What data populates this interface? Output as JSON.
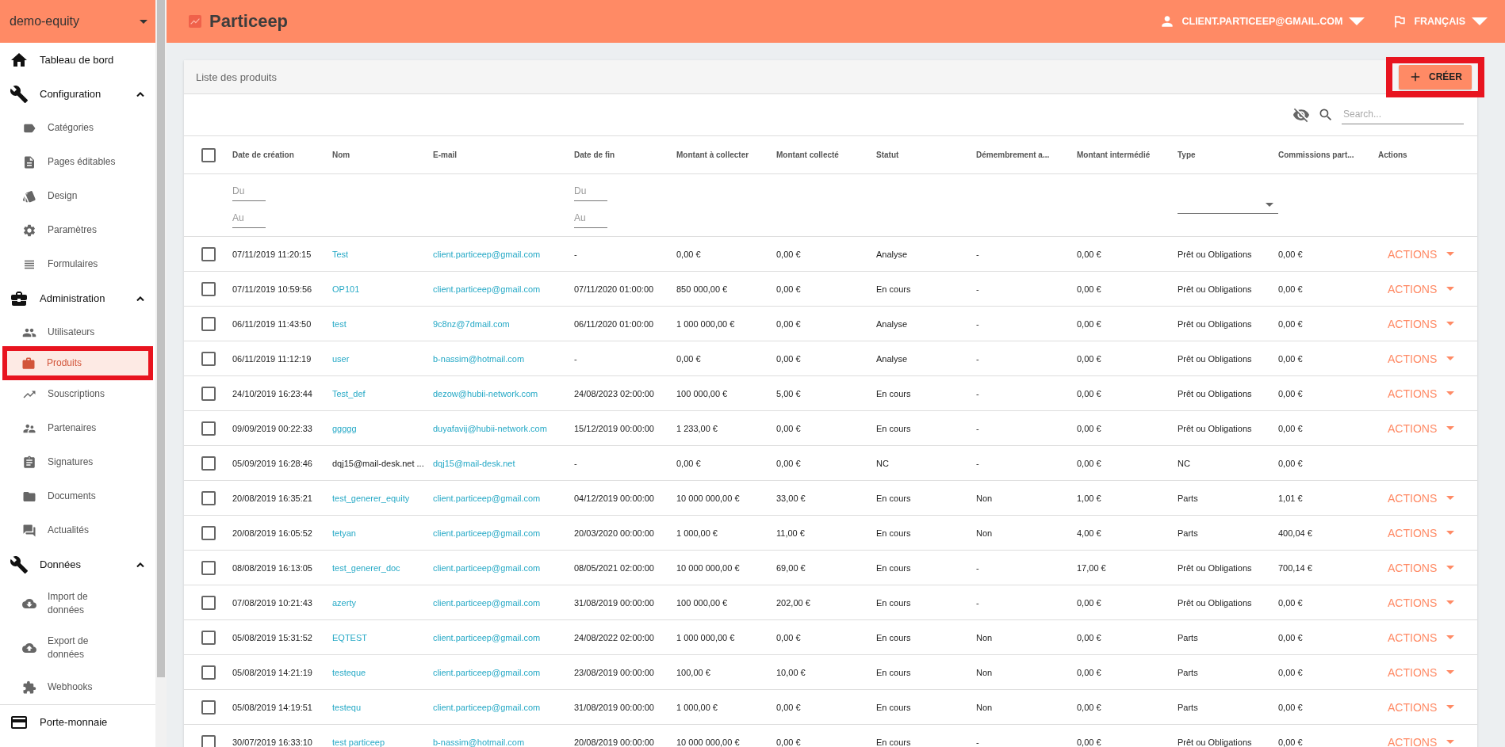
{
  "sidebar": {
    "account": "demo-equity",
    "sections": [
      {
        "label": "Tableau de bord",
        "kind": "link"
      },
      {
        "label": "Configuration",
        "kind": "group",
        "expanded": true,
        "children": [
          {
            "label": "Catégories",
            "selected": false,
            "highlighted": false
          },
          {
            "label": "Pages éditables",
            "selected": false,
            "highlighted": false
          },
          {
            "label": "Design",
            "selected": false,
            "highlighted": false
          },
          {
            "label": "Paramètres",
            "selected": false,
            "highlighted": false
          },
          {
            "label": "Formulaires",
            "selected": false,
            "highlighted": false
          }
        ]
      },
      {
        "label": "Administration",
        "kind": "group",
        "expanded": true,
        "children": [
          {
            "label": "Utilisateurs",
            "selected": false,
            "highlighted": false
          },
          {
            "label": "Produits",
            "selected": true,
            "highlighted": true
          },
          {
            "label": "Souscriptions",
            "selected": false,
            "highlighted": false
          },
          {
            "label": "Partenaires",
            "selected": false,
            "highlighted": false
          },
          {
            "label": "Signatures",
            "selected": false,
            "highlighted": false
          },
          {
            "label": "Documents",
            "selected": false,
            "highlighted": false
          },
          {
            "label": "Actualités",
            "selected": false,
            "highlighted": false
          }
        ]
      },
      {
        "label": "Données",
        "kind": "group",
        "expanded": true,
        "children": [
          {
            "label": "Import de données",
            "selected": false,
            "highlighted": false
          },
          {
            "label": "Export de données",
            "selected": false,
            "highlighted": false
          },
          {
            "label": "Webhooks",
            "selected": false,
            "highlighted": false
          }
        ]
      },
      {
        "label": "Porte-monnaie",
        "kind": "link"
      }
    ]
  },
  "header": {
    "brand": "Particeep",
    "user": "CLIENT.PARTICEEP@GMAIL.COM",
    "language": "FRANÇAIS"
  },
  "card": {
    "title": "Liste des produits",
    "create_button": {
      "label": "CRÉER",
      "highlighted": true
    },
    "search": {
      "placeholder": "Search..."
    },
    "table": {
      "columns": [
        "Date de création",
        "Nom",
        "E-mail",
        "Date de fin",
        "Montant à collecter",
        "Montant collecté",
        "Statut",
        "Démembrement a...",
        "Montant intermédié",
        "Type",
        "Commissions part...",
        "Actions"
      ],
      "all_checked": false,
      "filters": {
        "created_from": {
          "placeholder": "Du"
        },
        "created_to": {
          "placeholder": "Au"
        },
        "end_from": {
          "placeholder": "Du"
        },
        "end_to": {
          "placeholder": "Au"
        }
      },
      "rows": [
        {
          "checked": false,
          "created": "07/11/2019 11:20:15",
          "name": "Test",
          "name_link": true,
          "email": "client.particeep@gmail.com",
          "end": "-",
          "target": "0,00 €",
          "collected": "0,00 €",
          "status": "Analyse",
          "split": "-",
          "intermediated": "0,00 €",
          "type": "Prêt ou Obligations",
          "commission": "0,00 €",
          "actions": "ACTIONS"
        },
        {
          "checked": false,
          "created": "07/11/2019 10:59:56",
          "name": "OP101",
          "name_link": true,
          "email": "client.particeep@gmail.com",
          "end": "07/11/2020 01:00:00",
          "target": "850 000,00 €",
          "collected": "0,00 €",
          "status": "En cours",
          "split": "-",
          "intermediated": "0,00 €",
          "type": "Prêt ou Obligations",
          "commission": "0,00 €",
          "actions": "ACTIONS"
        },
        {
          "checked": false,
          "created": "06/11/2019 11:43:50",
          "name": "test",
          "name_link": true,
          "email": "9c8nz@7dmail.com",
          "end": "06/11/2020 01:00:00",
          "target": "1 000 000,00 €",
          "collected": "0,00 €",
          "status": "Analyse",
          "split": "-",
          "intermediated": "0,00 €",
          "type": "Prêt ou Obligations",
          "commission": "0,00 €",
          "actions": "ACTIONS"
        },
        {
          "checked": false,
          "created": "06/11/2019 11:12:19",
          "name": "user",
          "name_link": true,
          "email": "b-nassim@hotmail.com",
          "end": "-",
          "target": "0,00 €",
          "collected": "0,00 €",
          "status": "Analyse",
          "split": "-",
          "intermediated": "0,00 €",
          "type": "Prêt ou Obligations",
          "commission": "0,00 €",
          "actions": "ACTIONS"
        },
        {
          "checked": false,
          "created": "24/10/2019 16:23:44",
          "name": "Test_def",
          "name_link": true,
          "email": "dezow@hubii-network.com",
          "end": "24/08/2023 02:00:00",
          "target": "100 000,00 €",
          "collected": "5,00 €",
          "status": "En cours",
          "split": "-",
          "intermediated": "0,00 €",
          "type": "Prêt ou Obligations",
          "commission": "0,00 €",
          "actions": "ACTIONS"
        },
        {
          "checked": false,
          "created": "09/09/2019 00:22:33",
          "name": "ggggg",
          "name_link": true,
          "email": "duyafavij@hubii-network.com",
          "end": "15/12/2019 00:00:00",
          "target": "1 233,00 €",
          "collected": "0,00 €",
          "status": "En cours",
          "split": "-",
          "intermediated": "0,00 €",
          "type": "Prêt ou Obligations",
          "commission": "0,00 €",
          "actions": "ACTIONS"
        },
        {
          "checked": false,
          "created": "05/09/2019 16:28:46",
          "name": "dqj15@mail-desk.net ...",
          "name_link": false,
          "email": "dqj15@mail-desk.net",
          "end": "-",
          "target": "0,00 €",
          "collected": "0,00 €",
          "status": "NC",
          "split": "-",
          "intermediated": "0,00 €",
          "type": "NC",
          "commission": "0,00 €"
        },
        {
          "checked": false,
          "created": "20/08/2019 16:35:21",
          "name": "test_generer_equity",
          "name_link": true,
          "email": "client.particeep@gmail.com",
          "end": "04/12/2019 00:00:00",
          "target": "10 000 000,00 €",
          "collected": "33,00 €",
          "status": "En cours",
          "split": "Non",
          "intermediated": "1,00 €",
          "type": "Parts",
          "commission": "1,01 €",
          "actions": "ACTIONS"
        },
        {
          "checked": false,
          "created": "20/08/2019 16:05:52",
          "name": "tetyan",
          "name_link": true,
          "email": "client.particeep@gmail.com",
          "end": "20/03/2020 00:00:00",
          "target": "1 000,00 €",
          "collected": "11,00 €",
          "status": "En cours",
          "split": "Non",
          "intermediated": "4,00 €",
          "type": "Parts",
          "commission": "400,04 €",
          "actions": "ACTIONS"
        },
        {
          "checked": false,
          "created": "08/08/2019 16:13:05",
          "name": "test_generer_doc",
          "name_link": true,
          "email": "client.particeep@gmail.com",
          "end": "08/05/2021 02:00:00",
          "target": "10 000 000,00 €",
          "collected": "69,00 €",
          "status": "En cours",
          "split": "-",
          "intermediated": "17,00 €",
          "type": "Prêt ou Obligations",
          "commission": "700,14 €",
          "actions": "ACTIONS"
        },
        {
          "checked": false,
          "created": "07/08/2019 10:21:43",
          "name": "azerty",
          "name_link": true,
          "email": "client.particeep@gmail.com",
          "end": "31/08/2019 00:00:00",
          "target": "100 000,00 €",
          "collected": "202,00 €",
          "status": "En cours",
          "split": "-",
          "intermediated": "0,00 €",
          "type": "Prêt ou Obligations",
          "commission": "0,00 €",
          "actions": "ACTIONS"
        },
        {
          "checked": false,
          "created": "05/08/2019 15:31:52",
          "name": "EQTEST",
          "name_link": true,
          "email": "client.particeep@gmail.com",
          "end": "24/08/2022 02:00:00",
          "target": "1 000 000,00 €",
          "collected": "0,00 €",
          "status": "En cours",
          "split": "Non",
          "intermediated": "0,00 €",
          "type": "Parts",
          "commission": "0,00 €",
          "actions": "ACTIONS"
        },
        {
          "checked": false,
          "created": "05/08/2019 14:21:19",
          "name": "testeque",
          "name_link": true,
          "email": "client.particeep@gmail.com",
          "end": "23/08/2019 00:00:00",
          "target": "100,00 €",
          "collected": "10,00 €",
          "status": "En cours",
          "split": "Non",
          "intermediated": "0,00 €",
          "type": "Parts",
          "commission": "0,00 €",
          "actions": "ACTIONS"
        },
        {
          "checked": false,
          "created": "05/08/2019 14:19:51",
          "name": "testequ",
          "name_link": true,
          "email": "client.particeep@gmail.com",
          "end": "31/08/2019 00:00:00",
          "target": "1 000,00 €",
          "collected": "0,00 €",
          "status": "En cours",
          "split": "Non",
          "intermediated": "0,00 €",
          "type": "Parts",
          "commission": "0,00 €",
          "actions": "ACTIONS"
        },
        {
          "checked": false,
          "created": "30/07/2019 16:33:10",
          "name": "test particeep",
          "name_link": true,
          "email": "b-nassim@hotmail.com",
          "end": "20/08/2019 00:00:00",
          "target": "10 000 000,00 €",
          "collected": "0,00 €",
          "status": "En cours",
          "split": "-",
          "intermediated": "0,00 €",
          "type": "Prêt ou Obligations",
          "commission": "0,00 €",
          "actions": "ACTIONS"
        }
      ]
    }
  }
}
